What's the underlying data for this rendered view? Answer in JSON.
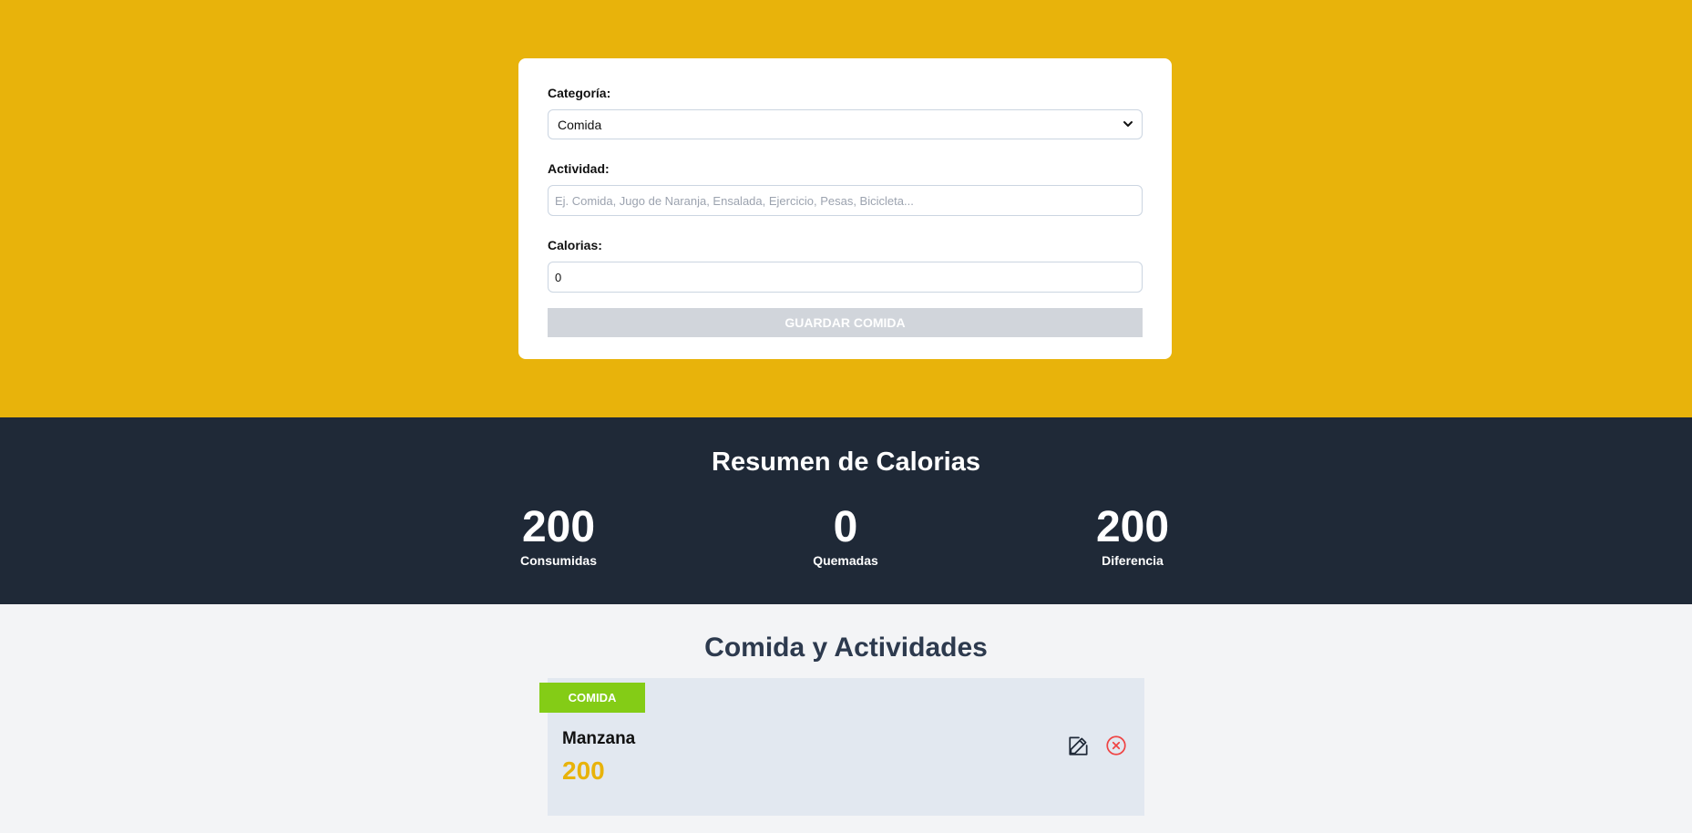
{
  "form": {
    "category_label": "Categoría:",
    "category_value": "Comida",
    "activity_label": "Actividad:",
    "activity_placeholder": "Ej. Comida, Jugo de Naranja, Ensalada, Ejercicio, Pesas, Bicicleta...",
    "calories_label": "Calorias:",
    "calories_value": "0",
    "save_button": "Guardar Comida"
  },
  "summary": {
    "title": "Resumen de Calorias",
    "stats": [
      {
        "value": "200",
        "label": "Consumidas"
      },
      {
        "value": "0",
        "label": "Quemadas"
      },
      {
        "value": "200",
        "label": "Diferencia"
      }
    ]
  },
  "activities": {
    "title": "Comida y Actividades",
    "items": [
      {
        "tag": "Comida",
        "name": "Manzana",
        "calories": "200",
        "actions": [
          "edit-icon",
          "close-circle-icon"
        ]
      }
    ]
  },
  "colors": {
    "header_bg": "#e8b30b",
    "summary_bg": "#1f2937",
    "tag_food": "#84cc16",
    "calories_accent": "#e8b30b",
    "delete_icon": "#ef4444"
  }
}
